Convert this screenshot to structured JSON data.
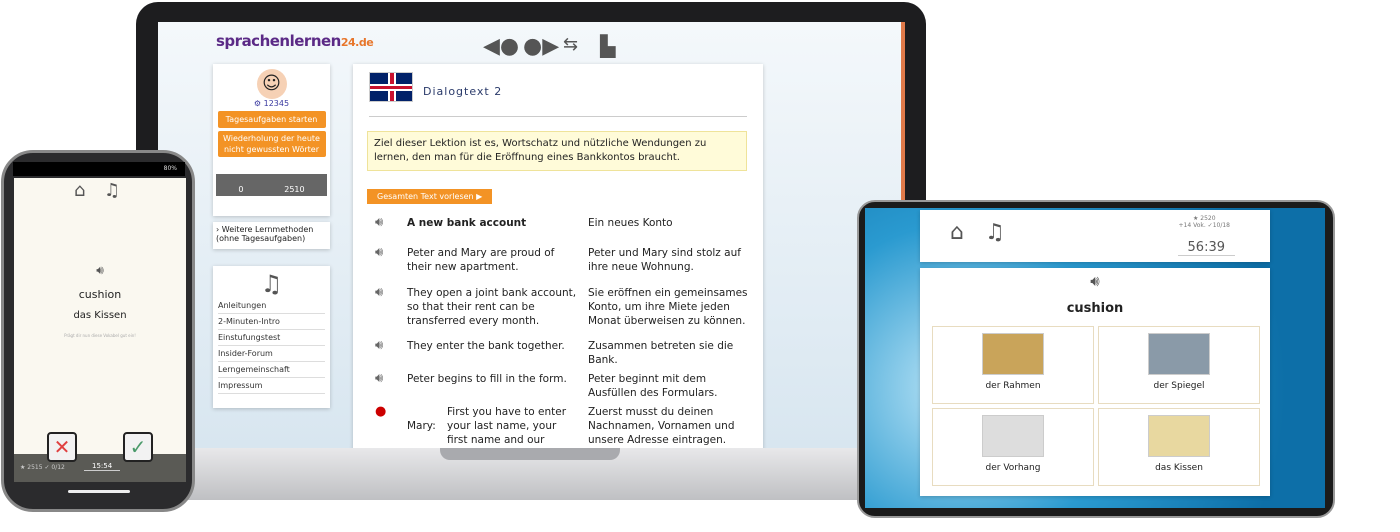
{
  "laptop": {
    "logo": "sprachenlernen24.de",
    "logo_main": "sprachenlernen",
    "logo_suffix": "24.de",
    "toolbar": [
      "back-icon",
      "forward-icon",
      "swap-icon",
      "print-icon"
    ],
    "profile": {
      "points": "⚙ 12345",
      "btn_daily": "Tagesaufgaben starten",
      "btn_review": "Wiederholung der heute nicht gewussten Wörter",
      "progress_min": "0",
      "progress_max": "2510"
    },
    "more_methods": "Weitere Lernmethoden (ohne Tagesaufgaben)",
    "menu": [
      "Anleitungen",
      "2-Minuten-Intro",
      "Einstufungstest",
      "Insider-Forum",
      "Lerngemeinschaft",
      "Impressum"
    ],
    "main": {
      "title": "Dialogtext 2",
      "goal": "Ziel dieser Lektion ist es, Wortschatz und nützliche Wendungen zu lernen, den man für die Eröffnung eines Bankkontos braucht.",
      "read_all": "Gesamten Text vorlesen ▶",
      "rows": [
        {
          "en": "A new bank account",
          "de": "Ein neues Konto"
        },
        {
          "en": "Peter and Mary are proud of their new apartment.",
          "de": "Peter und Mary sind stolz auf ihre neue Wohnung."
        },
        {
          "en": "They open a joint bank account, so that their rent can be transferred every month.",
          "de": "Sie eröffnen ein gemeinsames Konto, um ihre Miete jeden Monat überweisen zu können."
        },
        {
          "en": "They enter the bank together.",
          "de": "Zusammen betreten sie die Bank."
        },
        {
          "en": "Peter begins to fill in the form.",
          "de": "Peter beginnt mit dem Ausfüllen des Formulars."
        },
        {
          "speaker": "Mary:",
          "en": "First you have to enter your last name, your first name and our address.",
          "de": "Zuerst musst du deinen Nachnamen, Vornamen und unsere Adresse eintragen."
        }
      ]
    }
  },
  "phone": {
    "battery": "80%",
    "word": "cushion",
    "translation": "das Kissen",
    "hint": "Prägt dir nun diese Vokabel gut ein!",
    "stats": "★ 2515 ✓ 0/12",
    "time": "15:54"
  },
  "tablet": {
    "stars": "★ 2520",
    "stats": "+14 Vok. ✓10/18",
    "time": "56:39",
    "word": "cushion",
    "options": [
      "der Rahmen",
      "der Spiegel",
      "der Vorhang",
      "das Kissen"
    ]
  },
  "colors": {
    "accent": "#f39325",
    "brand": "#5b2a86"
  }
}
